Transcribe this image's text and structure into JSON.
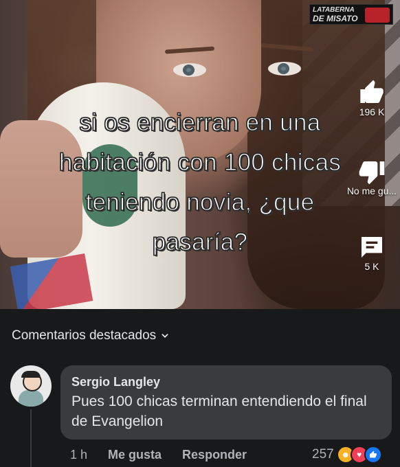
{
  "video": {
    "overlay_text": [
      "si os encierran en una",
      "habitación con 100 chicas",
      "teniendo novia, ¿que",
      "pasaría?"
    ],
    "watermark_line1": "LATABERNA",
    "watermark_line2": "DE MISATO",
    "like_count": "196 K",
    "dislike_label": "No me gu...",
    "comment_count": "5 K"
  },
  "comments": {
    "header": "Comentarios destacados",
    "items": [
      {
        "author": "Sergio Langley",
        "text": "Pues 100 chicas terminan entendiendo el final de Evangelion",
        "time": "1 h",
        "like_action": "Me gusta",
        "reply_action": "Responder",
        "reaction_count": "257",
        "reactions": [
          "haha",
          "love",
          "like"
        ]
      }
    ]
  },
  "colors": {
    "background": "#18191a",
    "bubble": "#3a3b3c",
    "text_primary": "#e4e6eb",
    "text_secondary": "#b0b3b8",
    "like_blue": "#1877f2",
    "love_red": "#f33e58",
    "haha_yellow": "#f7b125"
  },
  "icons": [
    "thumbs-up-icon",
    "thumbs-down-icon",
    "comment-icon",
    "chevron-down-icon",
    "haha-reaction-icon",
    "love-reaction-icon",
    "like-reaction-icon"
  ]
}
